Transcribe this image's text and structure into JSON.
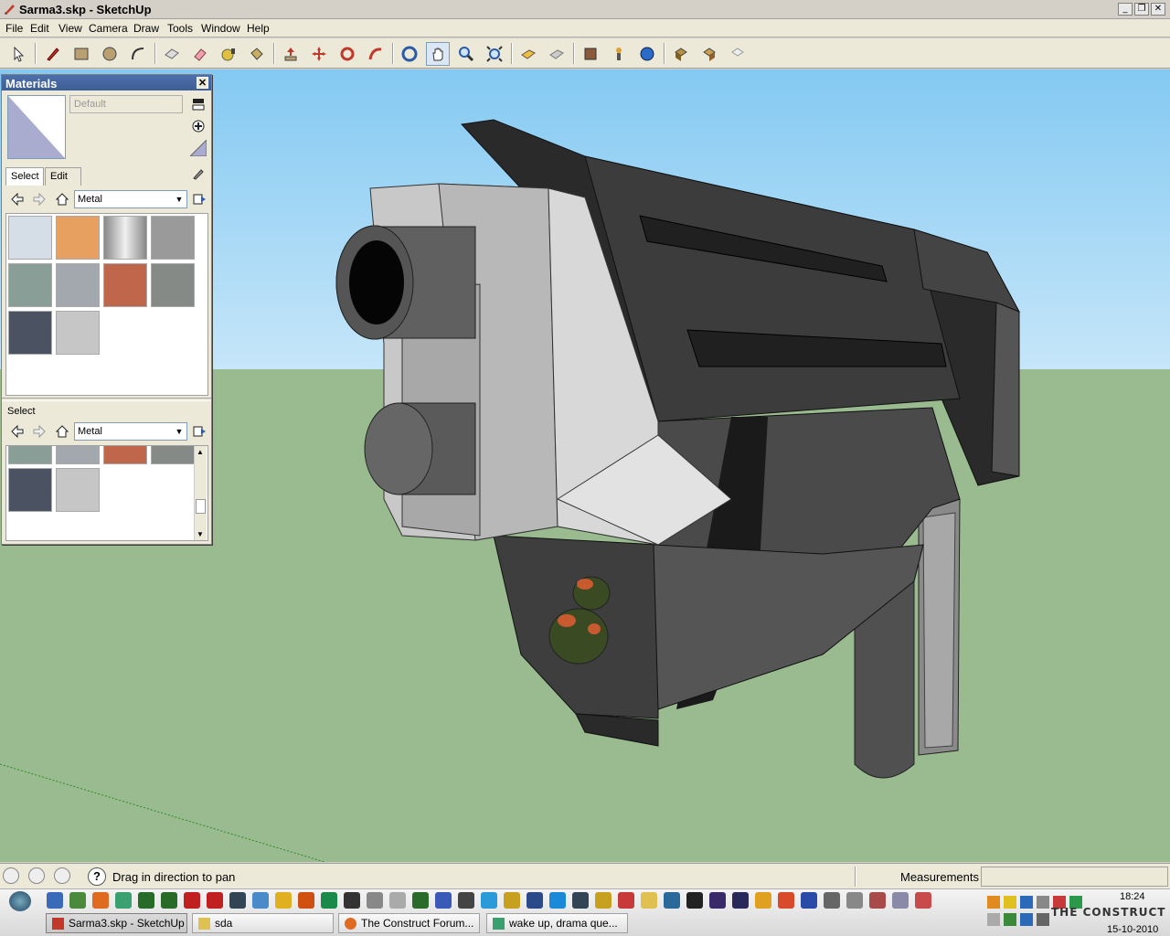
{
  "window": {
    "title": "Sarma3.skp - SketchUp"
  },
  "menu": [
    "File",
    "Edit",
    "View",
    "Camera",
    "Draw",
    "Tools",
    "Window",
    "Help"
  ],
  "toolbar": {
    "icons": [
      "select-icon",
      "pencil-icon",
      "rectangle-icon",
      "circle-icon",
      "arc-icon",
      "make-component-icon",
      "eraser-icon",
      "tape-measure-icon",
      "paint-bucket-icon",
      "push-pull-icon",
      "move-icon",
      "rotate-icon",
      "follow-me-icon",
      "orbit-icon",
      "pan-icon",
      "zoom-icon",
      "zoom-extents-icon",
      "previous-view-icon",
      "next-view-icon",
      "get-models-icon",
      "share-model-icon",
      "google-earth-icon",
      "get-components-icon",
      "share-component-icon",
      "dynamic-component-icon"
    ],
    "active": "pan-icon"
  },
  "materials": {
    "title": "Materials",
    "current_name": "Default",
    "tabs": [
      "Select",
      "Edit"
    ],
    "active_tab": "Select",
    "library": "Metal",
    "secondary_label": "Select",
    "secondary_library": "Metal",
    "swatches": [
      {
        "name": "metal-1",
        "color": "#d5dde6"
      },
      {
        "name": "metal-2",
        "color": "#e8a060"
      },
      {
        "name": "metal-3",
        "color": "#c8c8c8"
      },
      {
        "name": "metal-4",
        "color": "#9a9a9a"
      },
      {
        "name": "metal-5",
        "color": "#8a9e98"
      },
      {
        "name": "metal-6",
        "color": "#a2a8ad"
      },
      {
        "name": "metal-7",
        "color": "#c0664a"
      },
      {
        "name": "metal-8",
        "color": "#858a87"
      },
      {
        "name": "metal-9",
        "color": "#4b5262"
      },
      {
        "name": "metal-10",
        "color": "#c6c6c6"
      }
    ]
  },
  "status": {
    "hint": "Drag in direction to pan",
    "measurements_label": "Measurements",
    "measurements_value": ""
  },
  "taskbar": {
    "tasks": [
      {
        "label": "Sarma3.skp - SketchUp",
        "active": true
      },
      {
        "label": "sda",
        "active": false
      },
      {
        "label": "The Construct Forum...",
        "active": false
      },
      {
        "label": "wake up, drama que...",
        "active": false
      }
    ],
    "clock_time": "18:24",
    "clock_date": "15-10-2010",
    "watermark": "THE CONSTRUCT"
  },
  "colors": {
    "sky": "#84c9f2",
    "sky_bottom": "#c6e6f9",
    "ground": "#99bb8f"
  }
}
